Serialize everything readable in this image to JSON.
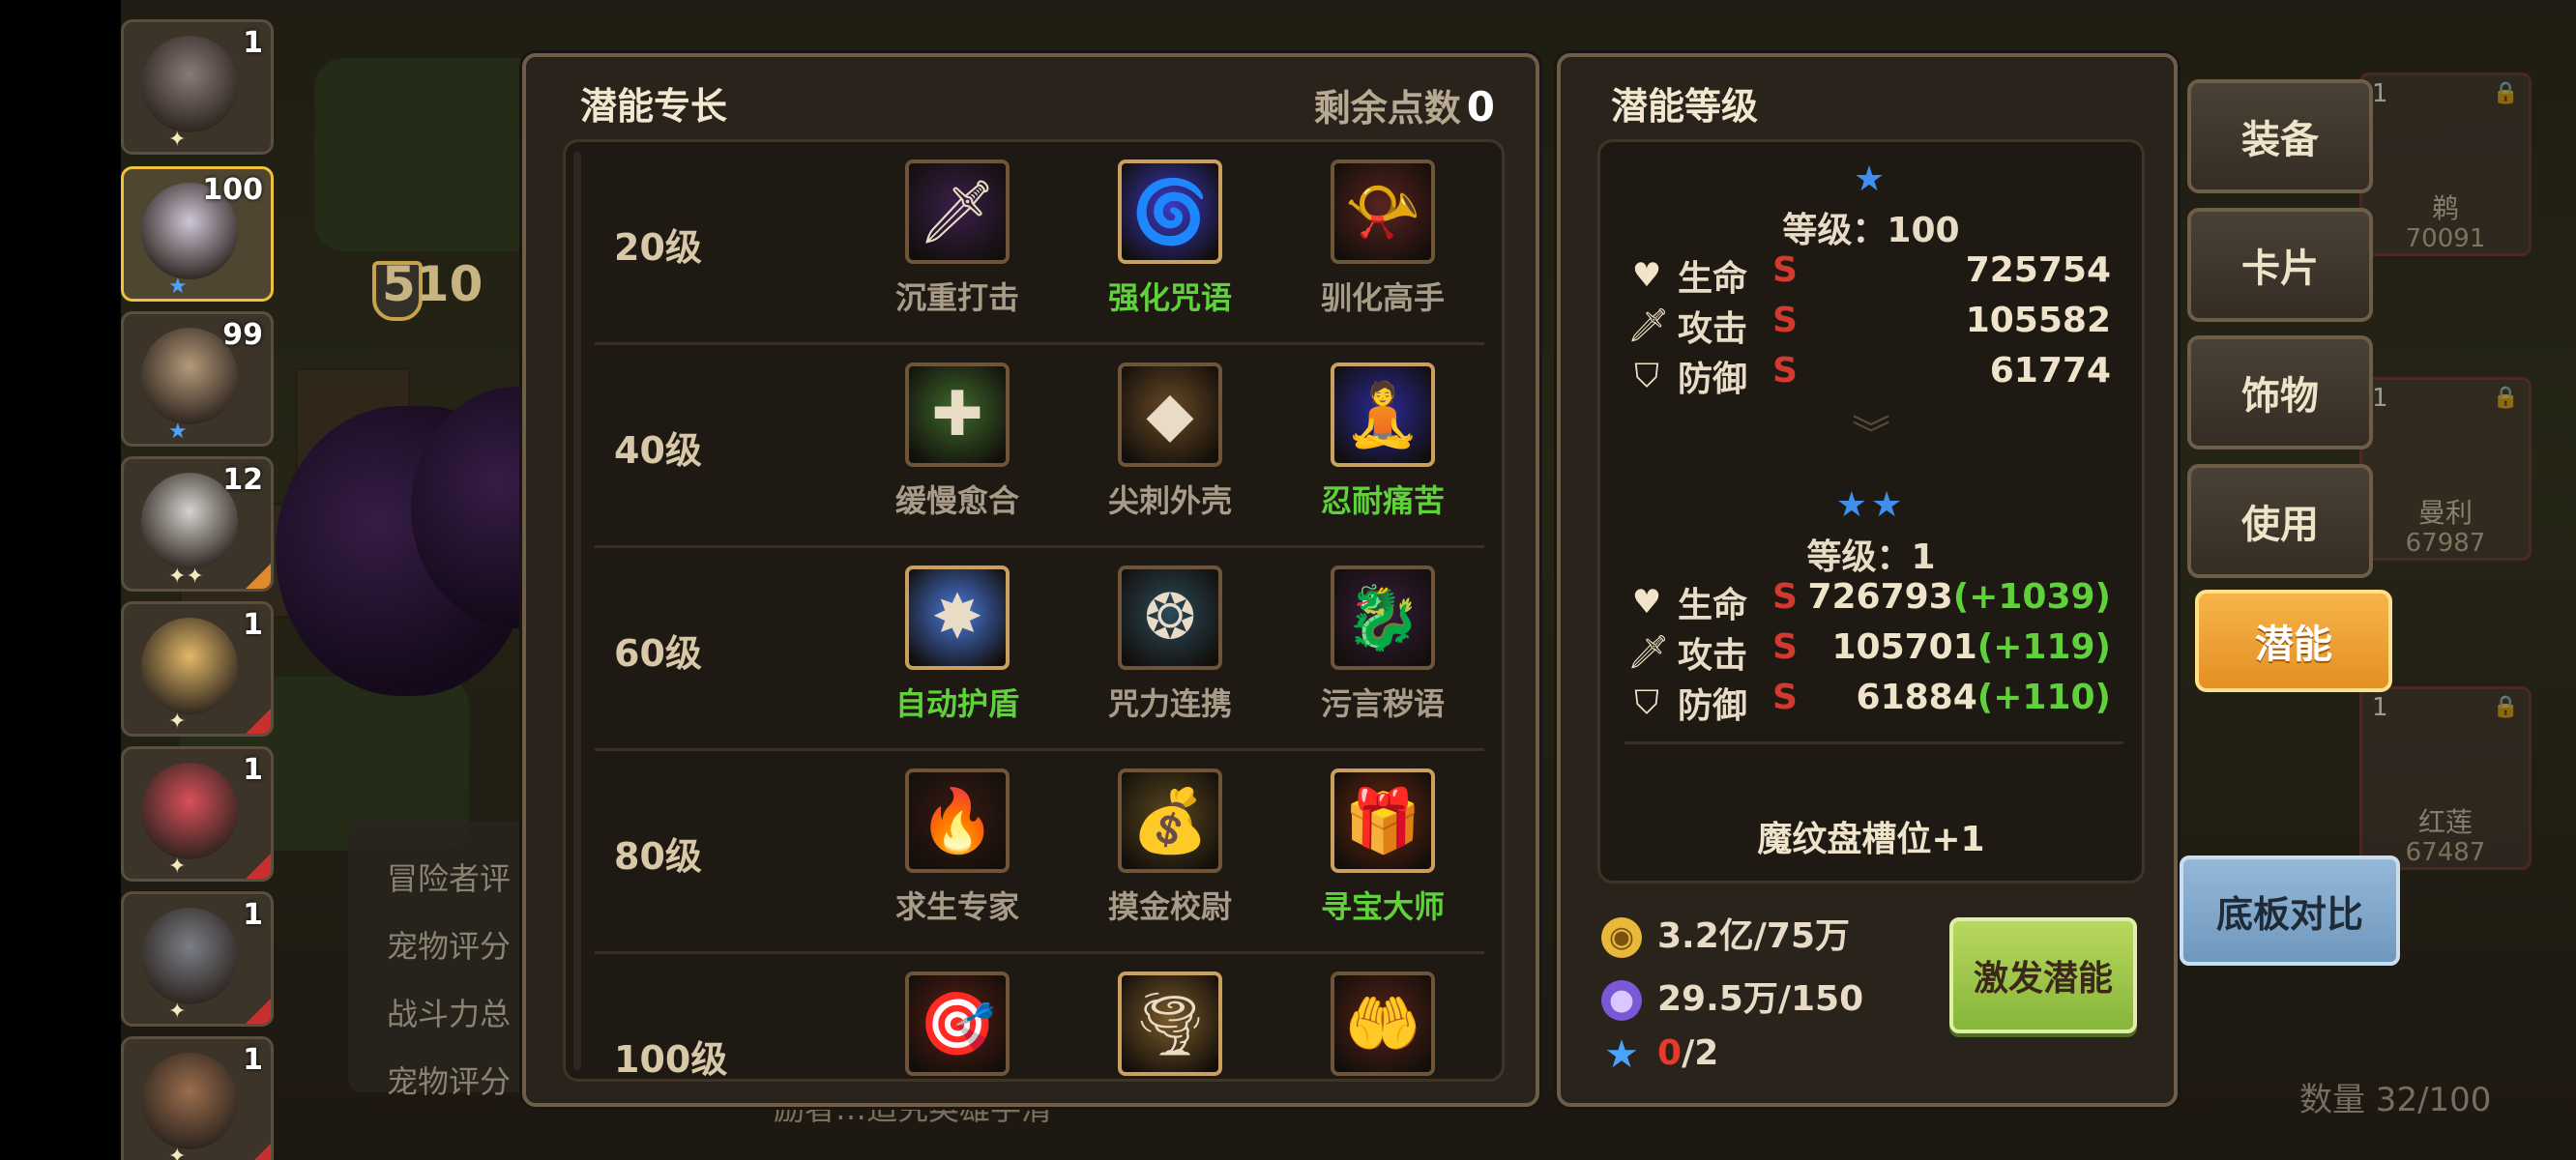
{
  "heroes": [
    {
      "level": "1",
      "stars": "✦",
      "starColor": "white",
      "face": "#8a7b78"
    },
    {
      "level": "100",
      "stars": "★",
      "starColor": "blue",
      "face": "#cfc6d8"
    },
    {
      "level": "99",
      "stars": "★",
      "starColor": "blue",
      "face": "#b59a7a"
    },
    {
      "level": "12",
      "stars": "✦✦",
      "starColor": "white",
      "face": "#d6d2ce"
    },
    {
      "level": "1",
      "stars": "✦",
      "starColor": "white",
      "face": "#e2b868"
    },
    {
      "level": "1",
      "stars": "✦",
      "starColor": "white",
      "face": "#d8505a"
    },
    {
      "level": "1",
      "stars": "✦",
      "starColor": "white",
      "face": "#7c7f88"
    },
    {
      "level": "1",
      "stars": "✦",
      "starColor": "white",
      "face": "#9a6e4c"
    }
  ],
  "scene": {
    "power": "510",
    "info_lines": [
      "冒险者评",
      "宠物评分",
      "战斗力总",
      "宠物评分"
    ],
    "bottom_text": "励者…追究英雄手清"
  },
  "talent_panel": {
    "title": "潜能专长",
    "remaining_label": "剩余点数",
    "remaining_value": "0",
    "tiers": [
      {
        "label": "20级",
        "skills": [
          {
            "name": "沉重打击",
            "learned": false,
            "icon": "sword-icon",
            "glyph": "🗡",
            "bg": "#3a1f4a"
          },
          {
            "name": "强化咒语",
            "learned": true,
            "icon": "swirl-magic-icon",
            "glyph": "🌀",
            "bg": "#3c3ac8"
          },
          {
            "name": "驯化高手",
            "learned": false,
            "icon": "whistle-icon",
            "glyph": "📯",
            "bg": "#5a2420"
          }
        ]
      },
      {
        "label": "40级",
        "skills": [
          {
            "name": "缓慢愈合",
            "learned": false,
            "icon": "heal-cross-icon",
            "glyph": "✚",
            "bg": "#3d6a2c"
          },
          {
            "name": "尖刺外壳",
            "learned": false,
            "icon": "spike-shell-icon",
            "glyph": "◆",
            "bg": "#6a4a26"
          },
          {
            "name": "忍耐痛苦",
            "learned": true,
            "icon": "meditation-icon",
            "glyph": "🧘",
            "bg": "#2a2a9a"
          }
        ]
      },
      {
        "label": "60级",
        "skills": [
          {
            "name": "自动护盾",
            "learned": true,
            "icon": "shield-burst-icon",
            "glyph": "✸",
            "bg": "#4a7ae0"
          },
          {
            "name": "咒力连携",
            "learned": false,
            "icon": "rune-circle-icon",
            "glyph": "❂",
            "bg": "#2c4a5a"
          },
          {
            "name": "污言秽语",
            "learned": false,
            "icon": "dark-beast-icon",
            "glyph": "🐉",
            "bg": "#3a1e3e"
          }
        ]
      },
      {
        "label": "80级",
        "skills": [
          {
            "name": "求生专家",
            "learned": false,
            "icon": "fire-orb-icon",
            "glyph": "🔥",
            "bg": "#3a1a14"
          },
          {
            "name": "摸金校尉",
            "learned": false,
            "icon": "gold-coins-icon",
            "glyph": "💰",
            "bg": "#5a4820"
          },
          {
            "name": "寻宝大师",
            "learned": true,
            "icon": "treasure-chest-icon",
            "glyph": "🎁",
            "bg": "#6a2a10"
          }
        ]
      },
      {
        "label": "100级",
        "skills": [
          {
            "name": "",
            "learned": false,
            "icon": "target-arrow-icon",
            "glyph": "🎯",
            "bg": "#5a2014"
          },
          {
            "name": "",
            "learned": true,
            "icon": "vortex-icon",
            "glyph": "🌪",
            "bg": "#7a5a2a"
          },
          {
            "name": "",
            "learned": false,
            "icon": "hands-orb-icon",
            "glyph": "🤲",
            "bg": "#5a2418"
          }
        ]
      }
    ]
  },
  "level_panel": {
    "title": "潜能等级",
    "current": {
      "stars": "★",
      "level_text": "等级：100",
      "stats": [
        {
          "name": "生命",
          "grade": "S",
          "value": "725754",
          "increase": "",
          "icon": "heart-icon",
          "glyph": "♥"
        },
        {
          "name": "攻击",
          "grade": "S",
          "value": "105582",
          "increase": "",
          "icon": "sword-icon",
          "glyph": "🗡"
        },
        {
          "name": "防御",
          "grade": "S",
          "value": "61774",
          "increase": "",
          "icon": "shield-icon",
          "glyph": "⛉"
        }
      ]
    },
    "next": {
      "stars": "★★",
      "level_text": "等级：1",
      "stats": [
        {
          "name": "生命",
          "grade": "S",
          "value": "726793",
          "increase": "(+1039)",
          "icon": "heart-icon",
          "glyph": "♥"
        },
        {
          "name": "攻击",
          "grade": "S",
          "value": "105701",
          "increase": "(+119)",
          "icon": "sword-icon",
          "glyph": "🗡"
        },
        {
          "name": "防御",
          "grade": "S",
          "value": "61884",
          "increase": "(+110)",
          "icon": "shield-icon",
          "glyph": "⛉"
        }
      ]
    },
    "bonus": "魔纹盘槽位+1",
    "costs": {
      "gold": "3.2亿/75万",
      "crystal": "29.5万/150",
      "star_have": "0",
      "star_need": "/2"
    },
    "activate_label": "激发潜能"
  },
  "side_tabs": [
    {
      "label": "装备",
      "active": false
    },
    {
      "label": "卡片",
      "active": false
    },
    {
      "label": "饰物",
      "active": false
    },
    {
      "label": "使用",
      "active": false
    },
    {
      "label": "潜能",
      "active": true
    }
  ],
  "compare_label": "底板对比",
  "bg_cards": [
    {
      "name": "鹈",
      "power": "70091",
      "level": "1"
    },
    {
      "name": "曼利",
      "power": "67987",
      "level": "1"
    },
    {
      "name": "红莲",
      "power": "67487",
      "level": "1"
    }
  ],
  "count_label": "数量 32/100",
  "colors": {
    "green_text": "#5fd13a",
    "red_grade": "#d23a2e",
    "accent_orange": "#f0a030",
    "star_blue": "#3f8fef"
  }
}
